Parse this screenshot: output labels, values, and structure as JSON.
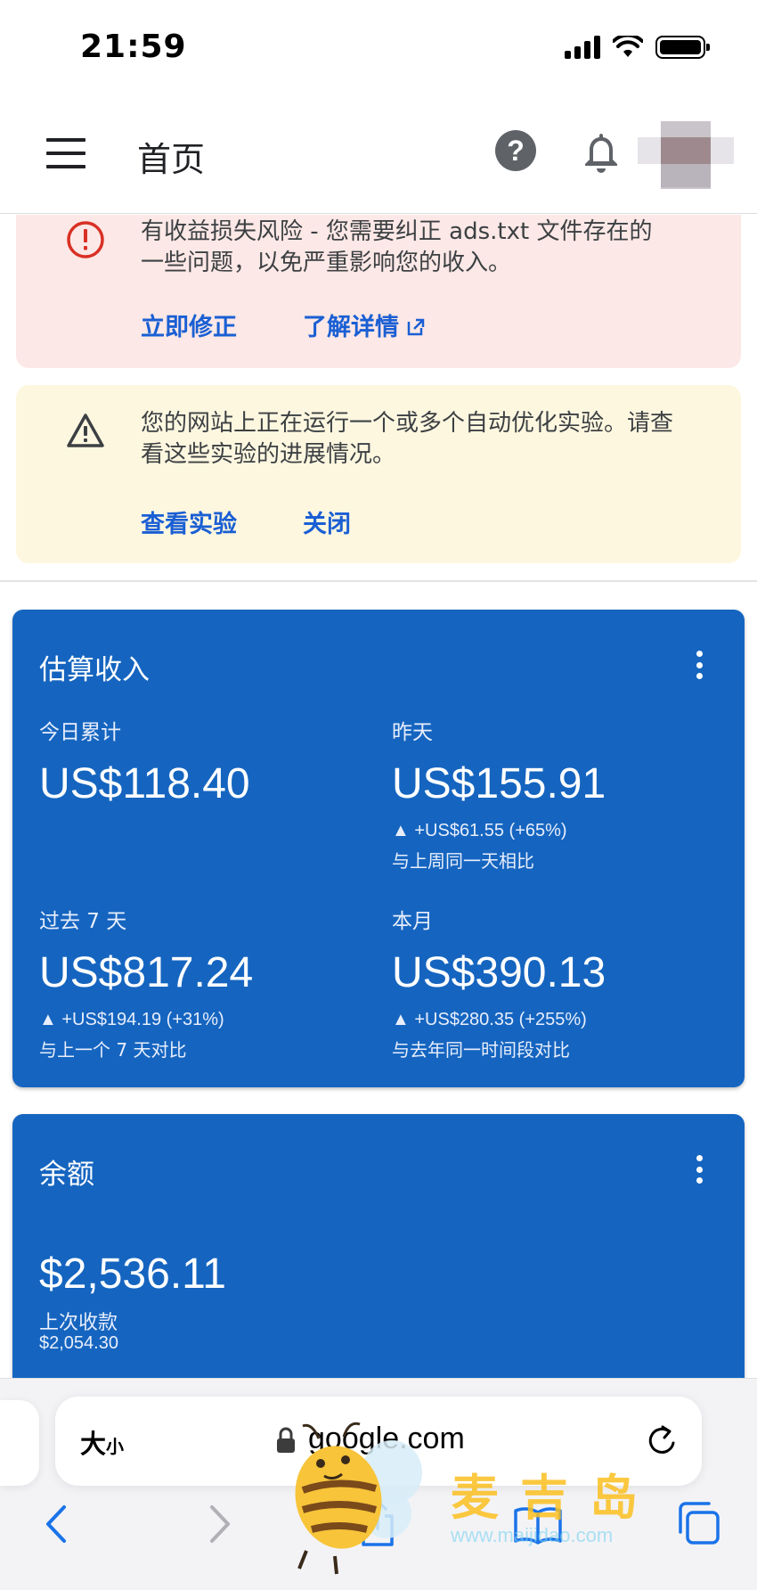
{
  "status_bar": {
    "time": "21:59"
  },
  "header": {
    "title": "首页"
  },
  "alert_error": {
    "text": "有收益损失风险 - 您需要纠正 ads.txt 文件存在的一些问题，以免严重影响您的收入。",
    "fix_label": "立即修正",
    "learn_more_label": "了解详情"
  },
  "alert_warning": {
    "text": "您的网站上正在运行一个或多个自动优化实验。请查看这些实验的进展情况。",
    "view_label": "查看实验",
    "close_label": "关闭"
  },
  "earnings": {
    "title": "估算收入",
    "today": {
      "label": "今日累计",
      "value": "US$118.40"
    },
    "yesterday": {
      "label": "昨天",
      "value": "US$155.91",
      "change": "▲ +US$61.55 (+65%)",
      "compare": "与上周同一天相比"
    },
    "last7": {
      "label": "过去 7 天",
      "value": "US$817.24",
      "change": "▲ +US$194.19 (+31%)",
      "compare": "与上一个 7 天对比"
    },
    "month": {
      "label": "本月",
      "value": "US$390.13",
      "change": "▲ +US$280.35 (+255%)",
      "compare": "与去年同一时间段对比"
    }
  },
  "balance": {
    "title": "余额",
    "value": "$2,536.11",
    "last_payment_label": "上次收款",
    "last_payment_value": "$2,054.30"
  },
  "browser": {
    "text_size_main": "大",
    "text_size_small": "小",
    "url": "google.com"
  },
  "watermark": {
    "brand": "麦吉岛",
    "site": "www.maijidao.com"
  },
  "colors": {
    "card_blue": "#1565c0",
    "link_blue": "#1a5fd4",
    "error_bg": "#fce8e6",
    "warn_bg": "#fef7e0",
    "error_red": "#d93025"
  }
}
